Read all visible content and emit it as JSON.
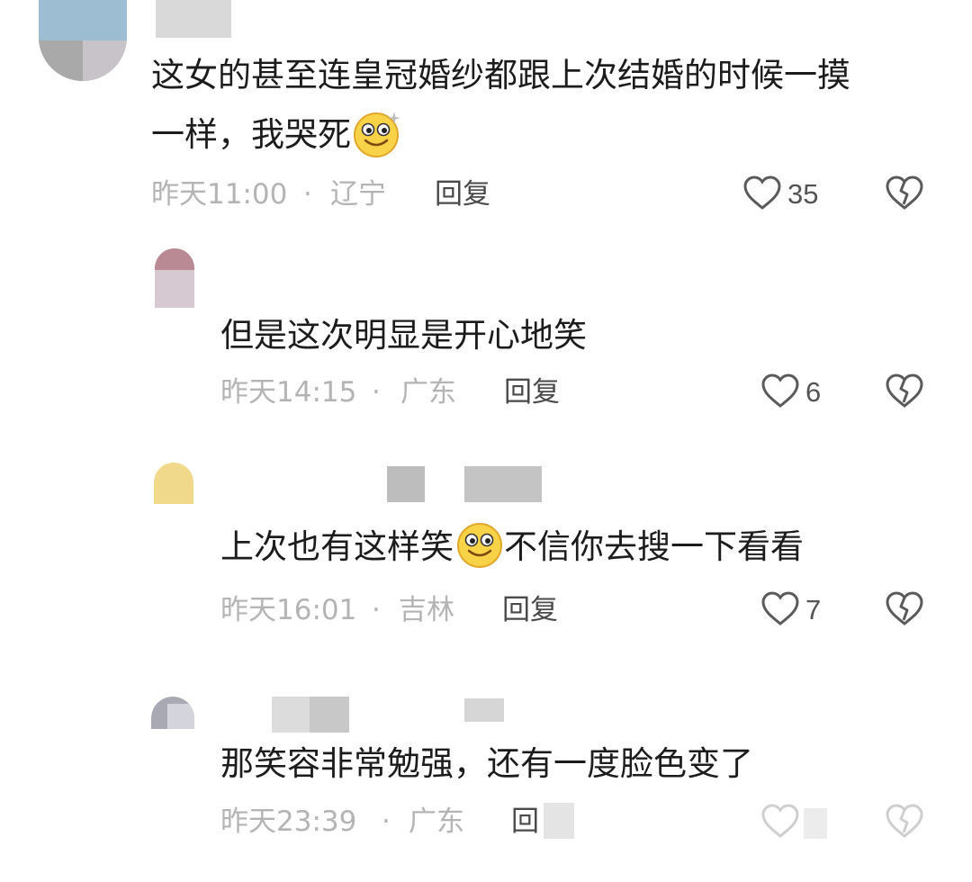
{
  "comments": [
    {
      "text_lines": [
        "这女的甚至连皇冠婚纱都跟上次结婚的时候一摸",
        "一样，我哭死"
      ],
      "time": "昨天11:00",
      "separator": "·",
      "location": "辽宁",
      "reply_label": "回复",
      "likes": "35"
    },
    {
      "text": "但是这次明显是开心地笑",
      "time": "昨天14:15",
      "separator": "·",
      "location": "广东",
      "reply_label": "回复",
      "likes": "6"
    },
    {
      "text_before": "上次也有这样笑",
      "text_after": "不信你去搜一下看看",
      "time": "昨天16:01",
      "separator": "·",
      "location": "吉林",
      "reply_label": "回复",
      "likes": "7"
    },
    {
      "text": "那笑容非常勉强，还有一度脸色变了",
      "time": "昨天23:39",
      "separator": "·",
      "location": "广东",
      "reply_label": "回"
    }
  ],
  "icons": {
    "like": "heart-outline-icon",
    "dislike": "broken-heart-icon",
    "emoji": "smiling-face-emoji"
  },
  "colors": {
    "text": "#1c1c1c",
    "meta": "#b4b4b4",
    "reply": "#4a4a4a",
    "icon": "#5a5a5a"
  }
}
